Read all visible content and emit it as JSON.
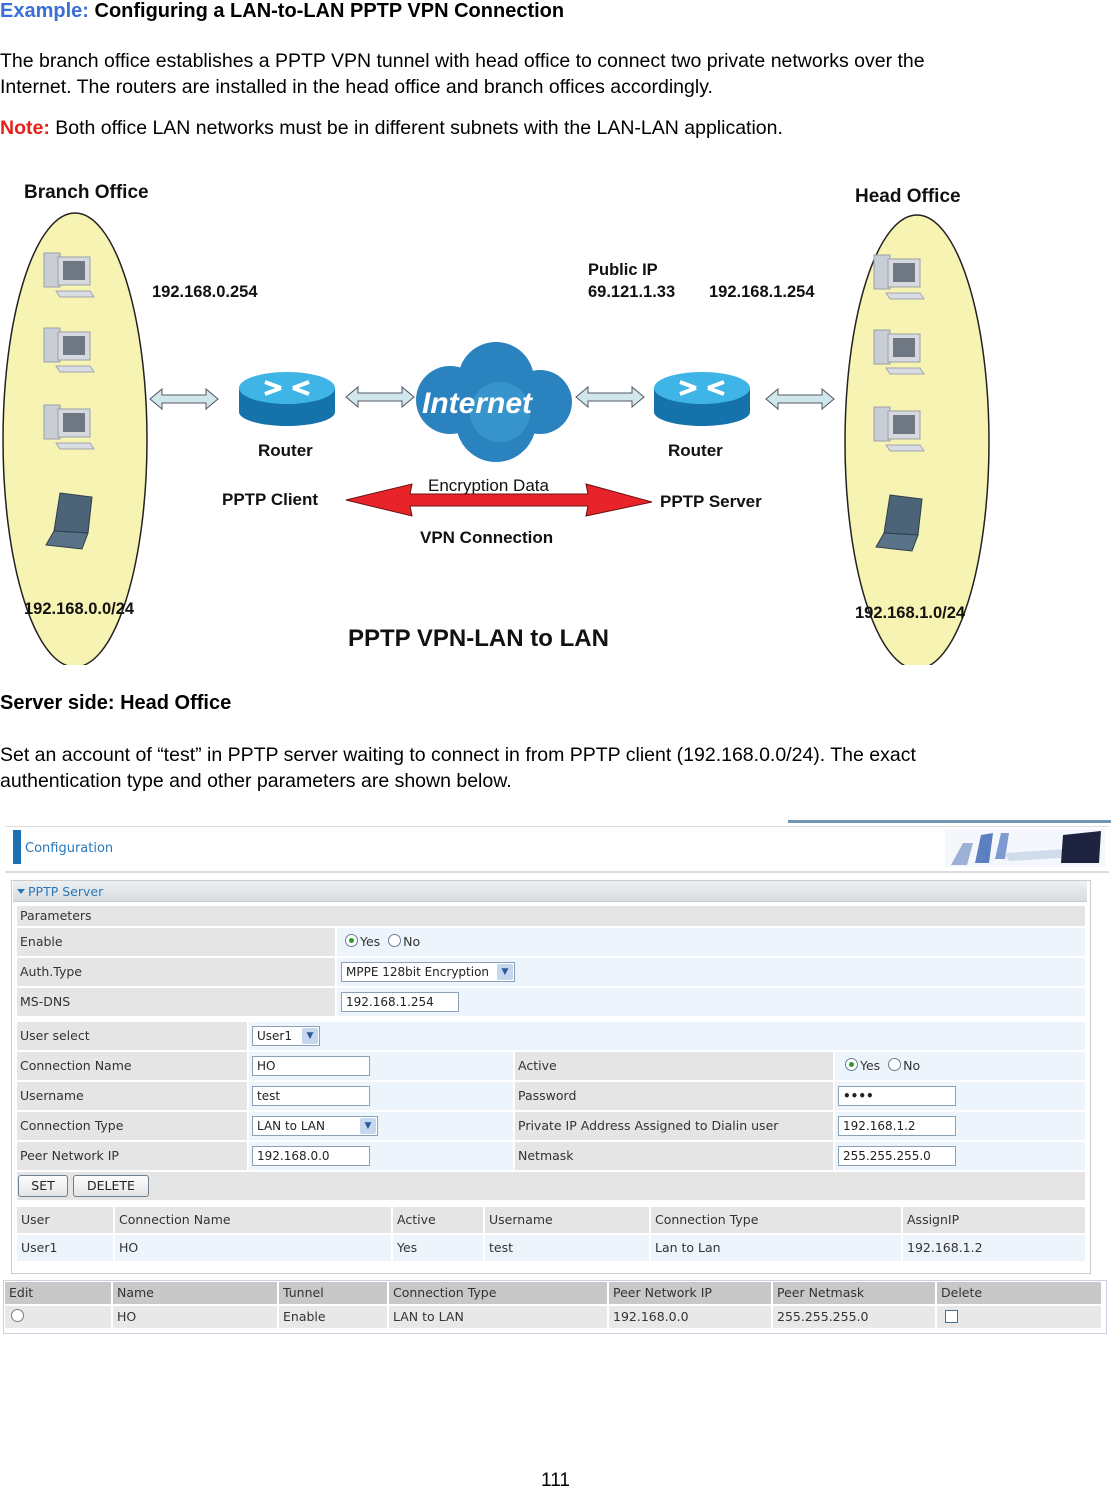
{
  "heading": {
    "label": "Example:",
    "title": "Configuring a LAN-to-LAN PPTP VPN Connection"
  },
  "intro": {
    "line1": "The branch office establishes a PPTP VPN tunnel with head office to connect two private networks over the",
    "line2": "Internet. The routers are installed in the head office and branch offices accordingly."
  },
  "note": {
    "label": "Note:",
    "text": " Both office LAN networks must be in different subnets with the LAN-LAN application."
  },
  "diagram": {
    "branch_title": "Branch Office",
    "head_title": "Head Office",
    "branch_gateway": "192.168.0.254",
    "public_ip_label": "Public IP",
    "public_ip": "69.121.1.33",
    "head_gateway": "192.168.1.254",
    "router_left": "Router",
    "router_right": "Router",
    "internet": "Internet",
    "encryption": "Encryption Data",
    "pptp_client": "PPTP Client",
    "pptp_server": "PPTP Server",
    "vpn_connection": "VPN Connection",
    "branch_subnet": "192.168.0.0/24",
    "head_subnet": "192.168.1.0/24",
    "caption": "PPTP VPN-LAN to LAN",
    "colors": {
      "ellipse": "#f7f3b2",
      "router": "#1e86c2",
      "cloud": "#2a82be",
      "arrow_red": "#e8242a",
      "arrow_light": "#cfe6ea"
    }
  },
  "server_side": {
    "heading": "Server side: Head Office",
    "line1": "Set an account of “test” in PPTP server waiting to connect in from PPTP client (192.168.0.0/24).  The exact",
    "line2": "authentication type and other parameters are shown below."
  },
  "ui": {
    "config_title": "Configuration",
    "panel_title": "PPTP Server",
    "parameters_label": "Parameters",
    "enable": {
      "label": "Enable",
      "options": [
        "Yes",
        "No"
      ],
      "selected": "Yes"
    },
    "auth_type": {
      "label": "Auth.Type",
      "value": "MPPE 128bit Encryption"
    },
    "ms_dns": {
      "label": "MS-DNS",
      "value": "192.168.1.254"
    },
    "user_select": {
      "label": "User select",
      "value": "User1"
    },
    "connection_name": {
      "label": "Connection Name",
      "value": "HO"
    },
    "active": {
      "label": "Active",
      "options": [
        "Yes",
        "No"
      ],
      "selected": "Yes"
    },
    "username": {
      "label": "Username",
      "value": "test"
    },
    "password": {
      "label": "Password",
      "value": "••••"
    },
    "connection_type": {
      "label": "Connection Type",
      "value": "LAN to LAN"
    },
    "private_ip": {
      "label": "Private IP Address Assigned to Dialin user",
      "value": "192.168.1.2"
    },
    "peer_network_ip": {
      "label": "Peer Network IP",
      "value": "192.168.0.0"
    },
    "netmask": {
      "label": "Netmask",
      "value": "255.255.255.0"
    },
    "set_button": "SET",
    "delete_button": "DELETE",
    "user_table": {
      "columns": [
        "User",
        "Connection Name",
        "Active",
        "Username",
        "Connection Type",
        "AssignIP"
      ],
      "rows": [
        [
          "User1",
          "HO",
          "Yes",
          "test",
          "Lan to Lan",
          "192.168.1.2"
        ]
      ]
    },
    "lan_table": {
      "columns": [
        "Edit",
        "Name",
        "Tunnel",
        "Connection Type",
        "Peer Network IP",
        "Peer Netmask",
        "Delete"
      ],
      "rows": [
        [
          "",
          "HO",
          "Enable",
          "LAN to LAN",
          "192.168.0.0",
          "255.255.255.0",
          ""
        ]
      ]
    }
  },
  "page_number": "111"
}
